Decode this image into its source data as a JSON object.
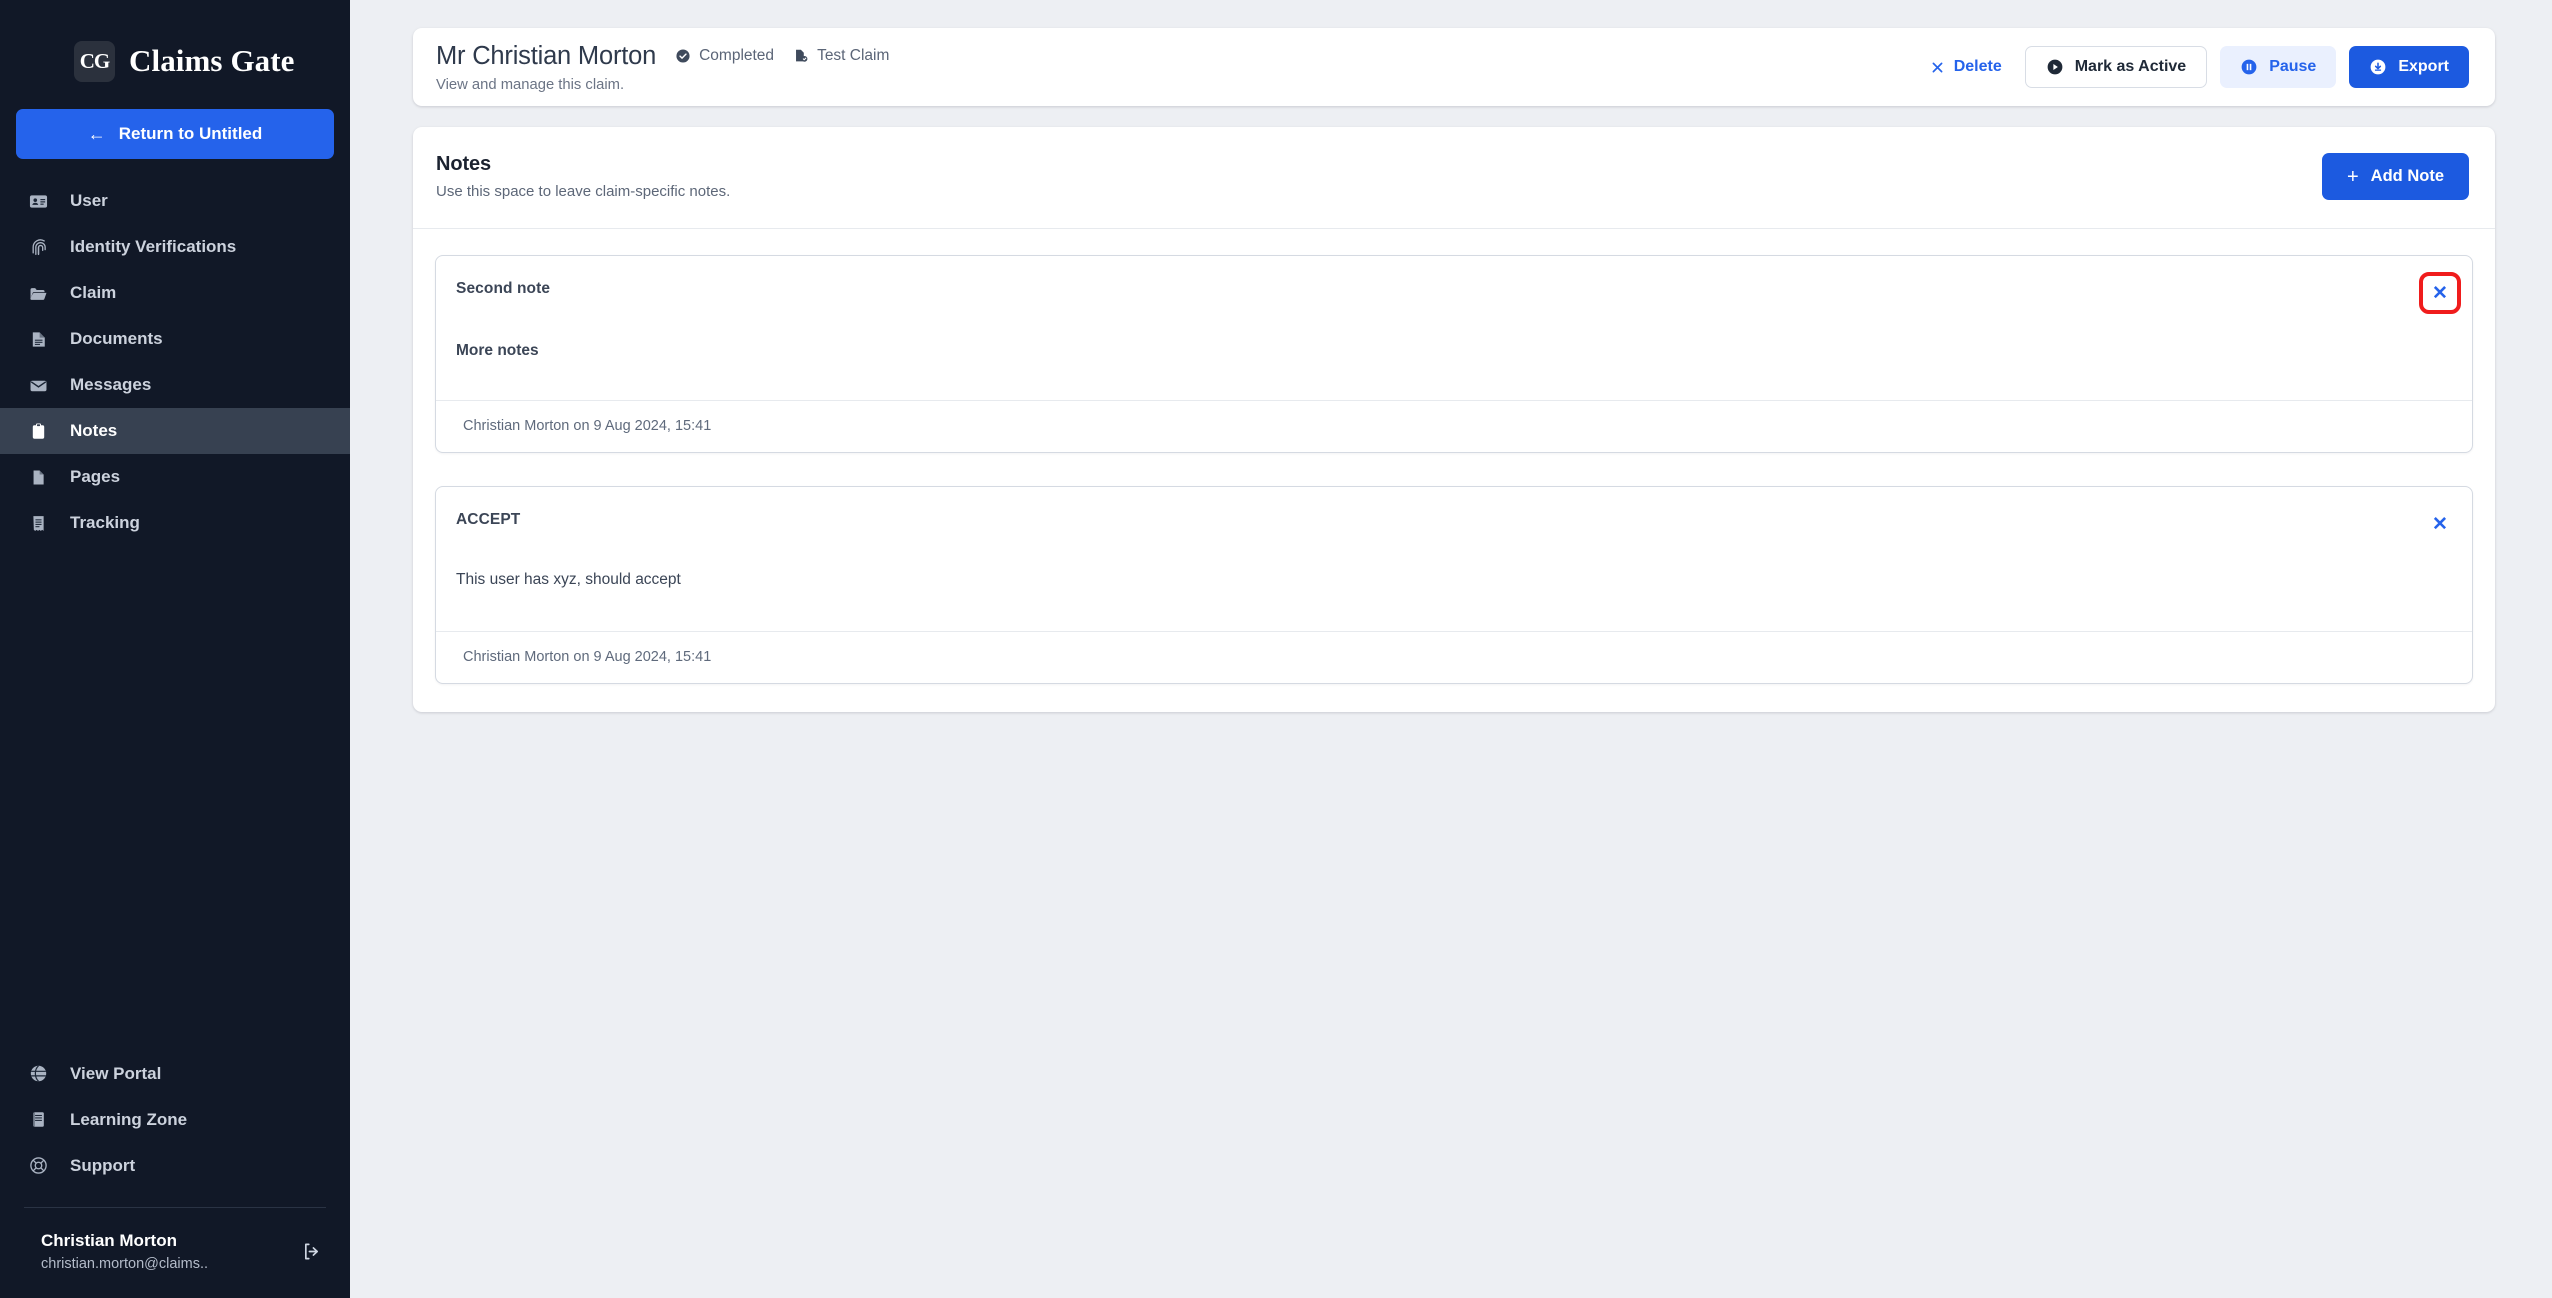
{
  "brand": {
    "logo_text": "CG",
    "logo_icon": "claims-gate-logo",
    "name": "Claims Gate"
  },
  "sidebar": {
    "return_button": {
      "label": "Return to Untitled",
      "icon": "arrow-left-icon",
      "arrow": "←"
    },
    "items": [
      {
        "label": "User",
        "icon": "id-card-icon",
        "active": false
      },
      {
        "label": "Identity Verifications",
        "icon": "fingerprint-icon",
        "active": false
      },
      {
        "label": "Claim",
        "icon": "folder-icon",
        "active": false
      },
      {
        "label": "Documents",
        "icon": "document-text-icon",
        "active": false
      },
      {
        "label": "Messages",
        "icon": "envelope-icon",
        "active": false
      },
      {
        "label": "Notes",
        "icon": "clipboard-icon",
        "active": true
      },
      {
        "label": "Pages",
        "icon": "page-icon",
        "active": false
      },
      {
        "label": "Tracking",
        "icon": "receipt-icon",
        "active": false
      }
    ],
    "bottom_items": [
      {
        "label": "View Portal",
        "icon": "globe-icon"
      },
      {
        "label": "Learning Zone",
        "icon": "book-icon"
      },
      {
        "label": "Support",
        "icon": "lifebuoy-icon"
      }
    ],
    "user": {
      "name": "Christian Morton",
      "email": "christian.morton@claims..",
      "logout_icon": "logout-icon"
    }
  },
  "header": {
    "title": "Mr Christian Morton",
    "subtitle": "View and manage this claim.",
    "badges": [
      {
        "label": "Completed",
        "icon": "check-circle-icon"
      },
      {
        "label": "Test Claim",
        "icon": "document-check-icon"
      }
    ],
    "actions": [
      {
        "label": "Delete",
        "icon": "x-icon",
        "style": "ghost"
      },
      {
        "label": "Mark as Active",
        "icon": "play-circle-icon",
        "style": "outline"
      },
      {
        "label": "Pause",
        "icon": "pause-circle-icon",
        "style": "soft"
      },
      {
        "label": "Export",
        "icon": "download-circle-icon",
        "style": "primary"
      }
    ]
  },
  "notes_panel": {
    "title": "Notes",
    "subtitle": "Use this space to leave claim-specific notes.",
    "add_button": {
      "label": "Add Note",
      "icon": "plus-icon",
      "plus": "+"
    },
    "close_icon": "close-icon",
    "close_glyph": "✕",
    "notes": [
      {
        "title": "Second note",
        "body": "More notes",
        "body_style": "bold",
        "footer": "Christian Morton on 9 Aug 2024, 15:41",
        "highlighted_close": true
      },
      {
        "title": "ACCEPT",
        "body": "This user has xyz, should accept",
        "body_style": "plain",
        "footer": "Christian Morton on 9 Aug 2024, 15:41",
        "highlighted_close": false
      }
    ]
  },
  "colors": {
    "sidebar_bg": "#111827",
    "sidebar_active": "#374151",
    "page_bg": "#edeff3",
    "accent_blue": "#2563eb",
    "primary_blue": "#1c5ae0",
    "soft_blue": "#eaf0fe",
    "highlight_red": "#f01c1c",
    "card_white": "#ffffff"
  }
}
